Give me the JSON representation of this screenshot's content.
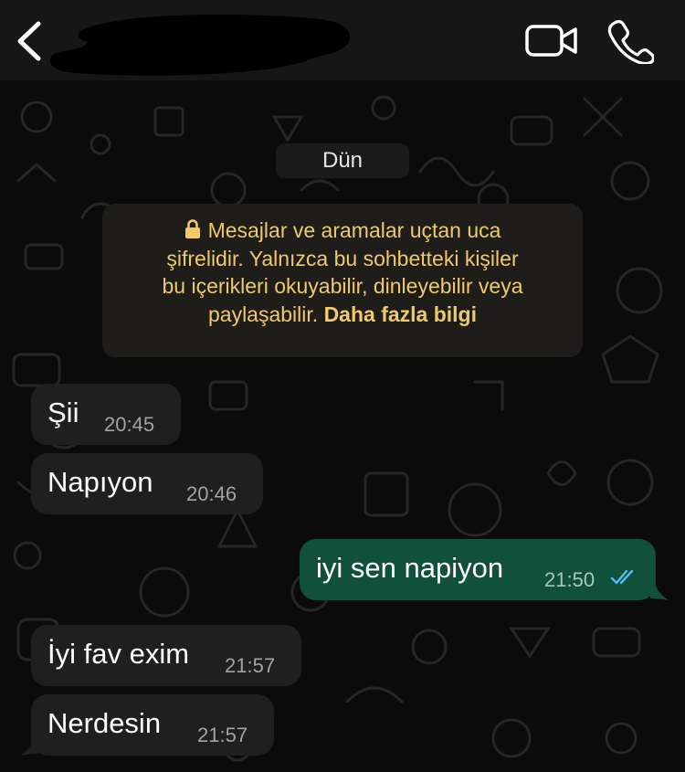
{
  "header": {
    "back_icon": "chevron-left-icon",
    "contact_name": "",
    "video_icon": "video-camera-icon",
    "call_icon": "phone-icon"
  },
  "chat": {
    "date_label": "Dün",
    "encryption_notice": {
      "icon": "lock-icon",
      "line1": "Mesajlar ve aramalar uçtan uca",
      "line2": "şifrelidir. Yalnızca bu sohbetteki kişiler",
      "line3": "bu içerikleri okuyabilir, dinleyebilir veya",
      "line4_text": "paylaşabilir.",
      "learn_more": "Daha fazla bilgi",
      "color": "#f0c96a"
    },
    "messages": [
      {
        "direction": "in",
        "text": "Şii",
        "time": "20:45"
      },
      {
        "direction": "in",
        "text": "Napıyon",
        "time": "20:46"
      },
      {
        "direction": "out",
        "text": "iyi sen napiyon",
        "time": "21:50",
        "status": "read"
      },
      {
        "direction": "in",
        "text": "İyi fav exim",
        "time": "21:57"
      },
      {
        "direction": "in",
        "text": "Nerdesin",
        "time": "21:57"
      }
    ]
  },
  "colors": {
    "incoming_bubble": "#1f1f1f",
    "outgoing_bubble": "#11503b",
    "read_ticks": "#53bdeb"
  }
}
